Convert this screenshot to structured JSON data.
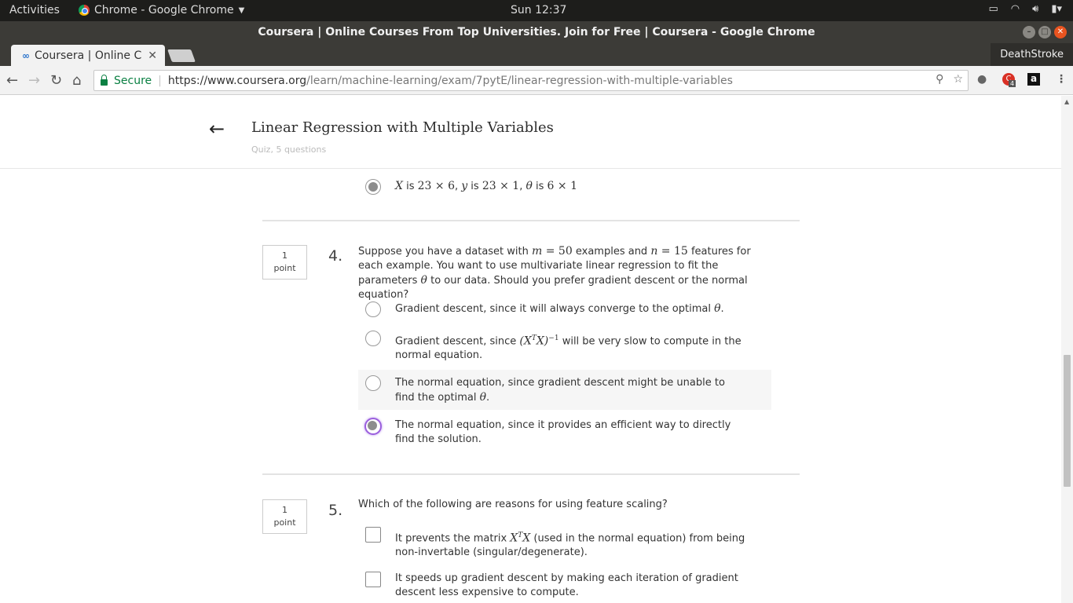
{
  "desktop": {
    "activities": "Activities",
    "app_menu": "Chrome - Google Chrome",
    "clock": "Sun 12:37"
  },
  "window": {
    "title": "Coursera | Online Courses From Top Universities. Join for Free | Coursera - Google Chrome"
  },
  "tabs": [
    {
      "label": "Coursera | Online C"
    }
  ],
  "profile": "DeathStroke",
  "address_bar": {
    "security": "Secure",
    "url_host": "https://www.coursera.org",
    "url_path": "/learn/machine-learning/exam/7pytE/linear-regression-with-multiple-variables",
    "extension_badge": "4"
  },
  "quiz": {
    "title": "Linear Regression with Multiple Variables",
    "subtitle": "Quiz, 5 questions"
  },
  "prev_option": {
    "selected": true,
    "parts": [
      "X",
      " is ",
      "23 × 6",
      ", ",
      "y",
      " is ",
      "23 × 1",
      ", ",
      "θ",
      " is ",
      "6 × 1"
    ]
  },
  "question4": {
    "number": "4.",
    "points_value": "1",
    "points_label": "point",
    "text_parts": [
      "Suppose you have a dataset with ",
      "m",
      " = 50",
      " examples and ",
      "n",
      " = 15",
      " features for each example. You want to use multivariate linear regression to fit the parameters ",
      "θ",
      " to our data. Should you prefer gradient descent or the normal equation?"
    ],
    "options": [
      {
        "parts": [
          "Gradient descent, since it will always converge to the optimal ",
          "θ",
          "."
        ],
        "selected": false
      },
      {
        "parts": [
          "Gradient descent, since ",
          "(X",
          "T",
          "X)",
          "−1",
          " will be very slow to compute in the normal equation."
        ],
        "selected": false
      },
      {
        "parts": [
          "The normal equation, since gradient descent might be unable to find the optimal ",
          "θ",
          "."
        ],
        "selected": false
      },
      {
        "parts": [
          "The normal equation, since it provides an efficient way to directly find the solution."
        ],
        "selected": true
      }
    ]
  },
  "question5": {
    "number": "5.",
    "points_value": "1",
    "points_label": "point",
    "text": "Which of the following are reasons for using feature scaling?",
    "options": [
      {
        "parts": [
          "It prevents the matrix ",
          "X",
          "T",
          "X",
          " (used in the normal equation) from being non-invertable (singular/degenerate)."
        ],
        "checked": false
      },
      {
        "parts": [
          "It speeds up gradient descent by making each iteration of gradient descent less expensive to compute."
        ],
        "checked": false
      }
    ]
  }
}
